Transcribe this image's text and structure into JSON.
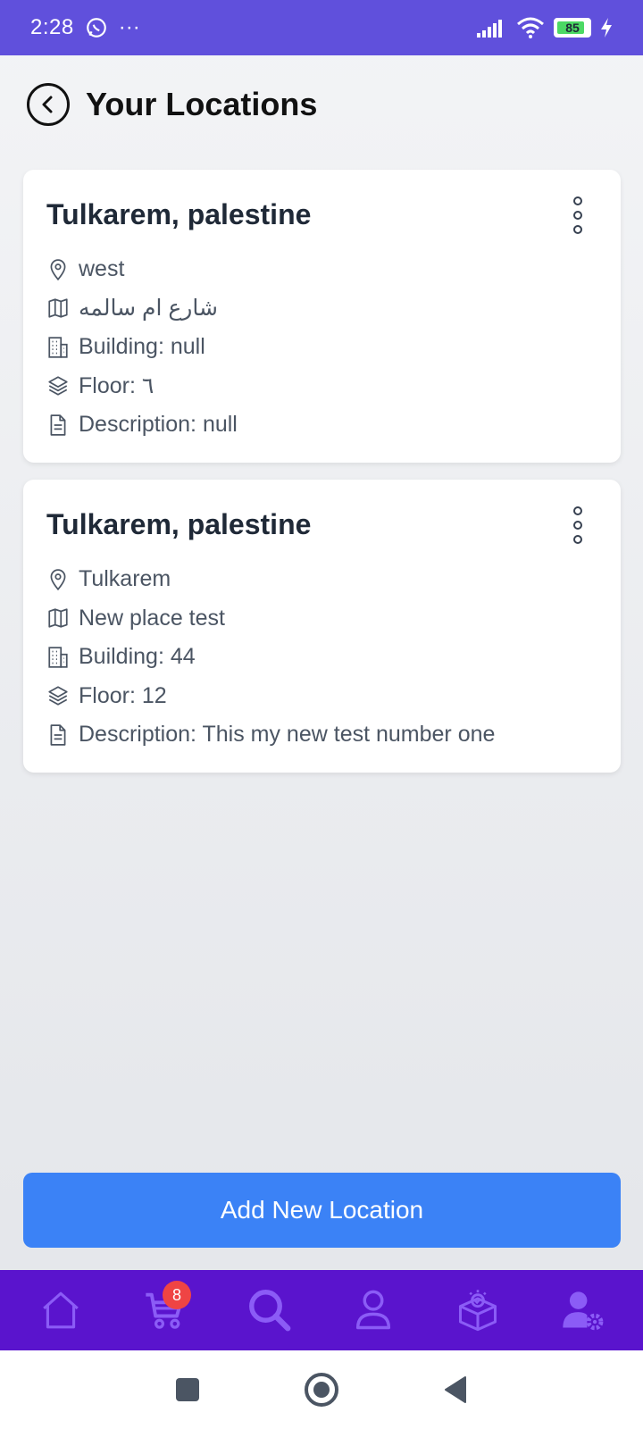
{
  "status_bar": {
    "time": "2:28",
    "dots": "···",
    "battery": "85"
  },
  "header": {
    "title": "Your Locations"
  },
  "locations": [
    {
      "title": "Tulkarem, palestine",
      "area": "west",
      "street": "شارع ام سالمه",
      "building": "Building: null",
      "floor": "Floor: ٦",
      "description": "Description: null"
    },
    {
      "title": "Tulkarem, palestine",
      "area": "Tulkarem",
      "street": "New place test",
      "building": "Building: 44",
      "floor": "Floor: 12",
      "description": "Description: This my new test number one"
    }
  ],
  "add_button": {
    "label": "Add New Location"
  },
  "bottom_nav": {
    "cart_count": "8",
    "icon_color": "#8b5cf6"
  },
  "colors": {
    "status_bar": "#6050dc",
    "nav_bar": "#5a14cd",
    "primary_button": "#3b82f6"
  }
}
